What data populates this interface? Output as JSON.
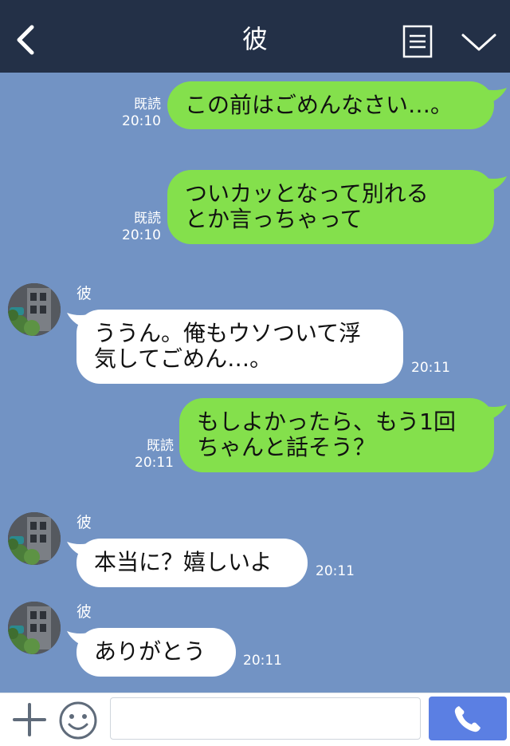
{
  "header": {
    "title": "彼",
    "back_icon": "chevron-left-icon",
    "menu_icon": "list-icon",
    "collapse_icon": "chevron-down-icon"
  },
  "messages": [
    {
      "from": "me",
      "text": "この前はごめんなさい…。",
      "read": "既読",
      "time": "20:10"
    },
    {
      "from": "me",
      "text": "ついカッとなって別れる\nとか言っちゃって",
      "read": "既読",
      "time": "20:10"
    },
    {
      "from": "them",
      "name": "彼",
      "text": "ううん。俺もウソついて浮\n気してごめん…。",
      "time": "20:11"
    },
    {
      "from": "me",
      "text": "もしよかったら、もう1回\nちゃんと話そう？",
      "read": "既読",
      "time": "20:11"
    },
    {
      "from": "them",
      "name": "彼",
      "text": "本当に？嬉しいよ",
      "time": "20:11"
    },
    {
      "from": "them",
      "name": "彼",
      "text": "ありがとう",
      "time": "20:11"
    }
  ],
  "input": {
    "value": "",
    "placeholder": ""
  },
  "colors": {
    "header_bg": "#233047",
    "chat_bg": "#7293c4",
    "my_bubble": "#84e04c",
    "their_bubble": "#ffffff",
    "call_button": "#5b7fe3"
  },
  "icons": {
    "plus": "plus-icon",
    "emoji": "smiley-icon",
    "call": "phone-icon"
  }
}
